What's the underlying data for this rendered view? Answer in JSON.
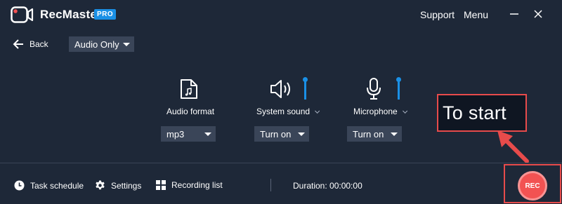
{
  "app": {
    "name": "RecMaster",
    "badge": "PRO"
  },
  "header": {
    "support": "Support",
    "menu": "Menu"
  },
  "toolbar": {
    "back_label": "Back",
    "mode": "Audio Only"
  },
  "controls": [
    {
      "label": "Audio format",
      "value": "mp3",
      "icon": "audio-file-icon"
    },
    {
      "label": "System sound",
      "value": "Turn on",
      "icon": "speaker-icon",
      "level": 0.8
    },
    {
      "label": "Microphone",
      "value": "Turn on",
      "icon": "microphone-icon",
      "level": 0.8
    }
  ],
  "annotation": {
    "text": "To start",
    "color": "#e74b4b"
  },
  "footer": {
    "task_schedule": "Task schedule",
    "settings": "Settings",
    "recording_list": "Recording list",
    "duration": "Duration: 00:00:00"
  },
  "rec_button": {
    "label": "REC",
    "color": "#f25252"
  },
  "colors": {
    "background": "#1e2838",
    "accent": "#1a90e6",
    "dropdown": "#3a4558"
  }
}
